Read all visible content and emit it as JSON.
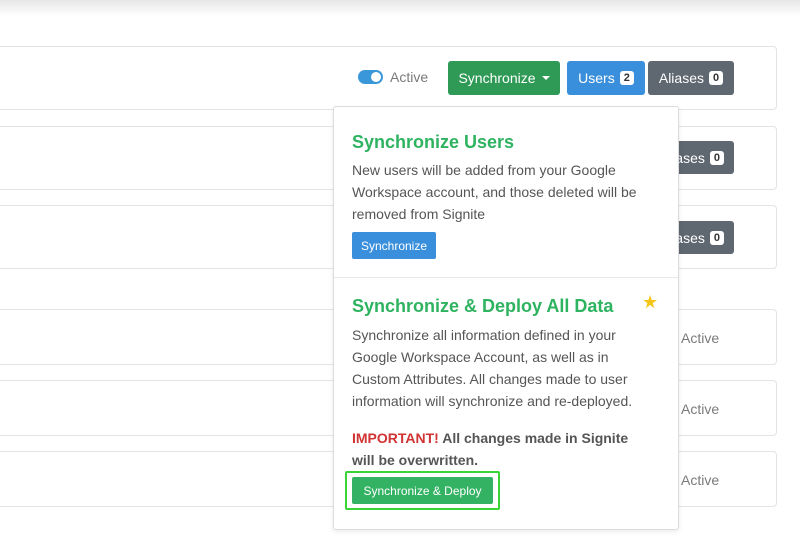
{
  "header": {
    "toggle_label": "Active"
  },
  "actions": {
    "synchronize_label": "Synchronize",
    "users_label": "Users",
    "users_count": "2",
    "aliases_label": "Aliases",
    "aliases_count": "0"
  },
  "rows": {
    "partial_aliases_label": "ases",
    "partial_aliases_count": "0",
    "status_text": "Active"
  },
  "dropdown": {
    "sync_users": {
      "title": "Synchronize Users",
      "description": "New users will be added from your Google Workspace account, and those deleted will be removed from Signite",
      "button_label": "Synchronize"
    },
    "sync_deploy": {
      "title": "Synchronize & Deploy All Data",
      "description": "Synchronize all information defined in your Google Workspace Account, as well as in Custom Attributes. All changes made to user information will synchronize and re-deployed.",
      "important_label": "IMPORTANT!",
      "important_text": "All changes made in Signite will be overwritten.",
      "button_label": "Synchronize & Deploy",
      "star_icon": "star-icon"
    }
  },
  "colors": {
    "green_primary": "#2e9a55",
    "blue_primary": "#3a8fdc",
    "gray_secondary": "#5f6770",
    "title_green": "#2eb360",
    "important_red": "#d13232",
    "highlight_border": "#39d436",
    "star_yellow": "#f4c517"
  }
}
